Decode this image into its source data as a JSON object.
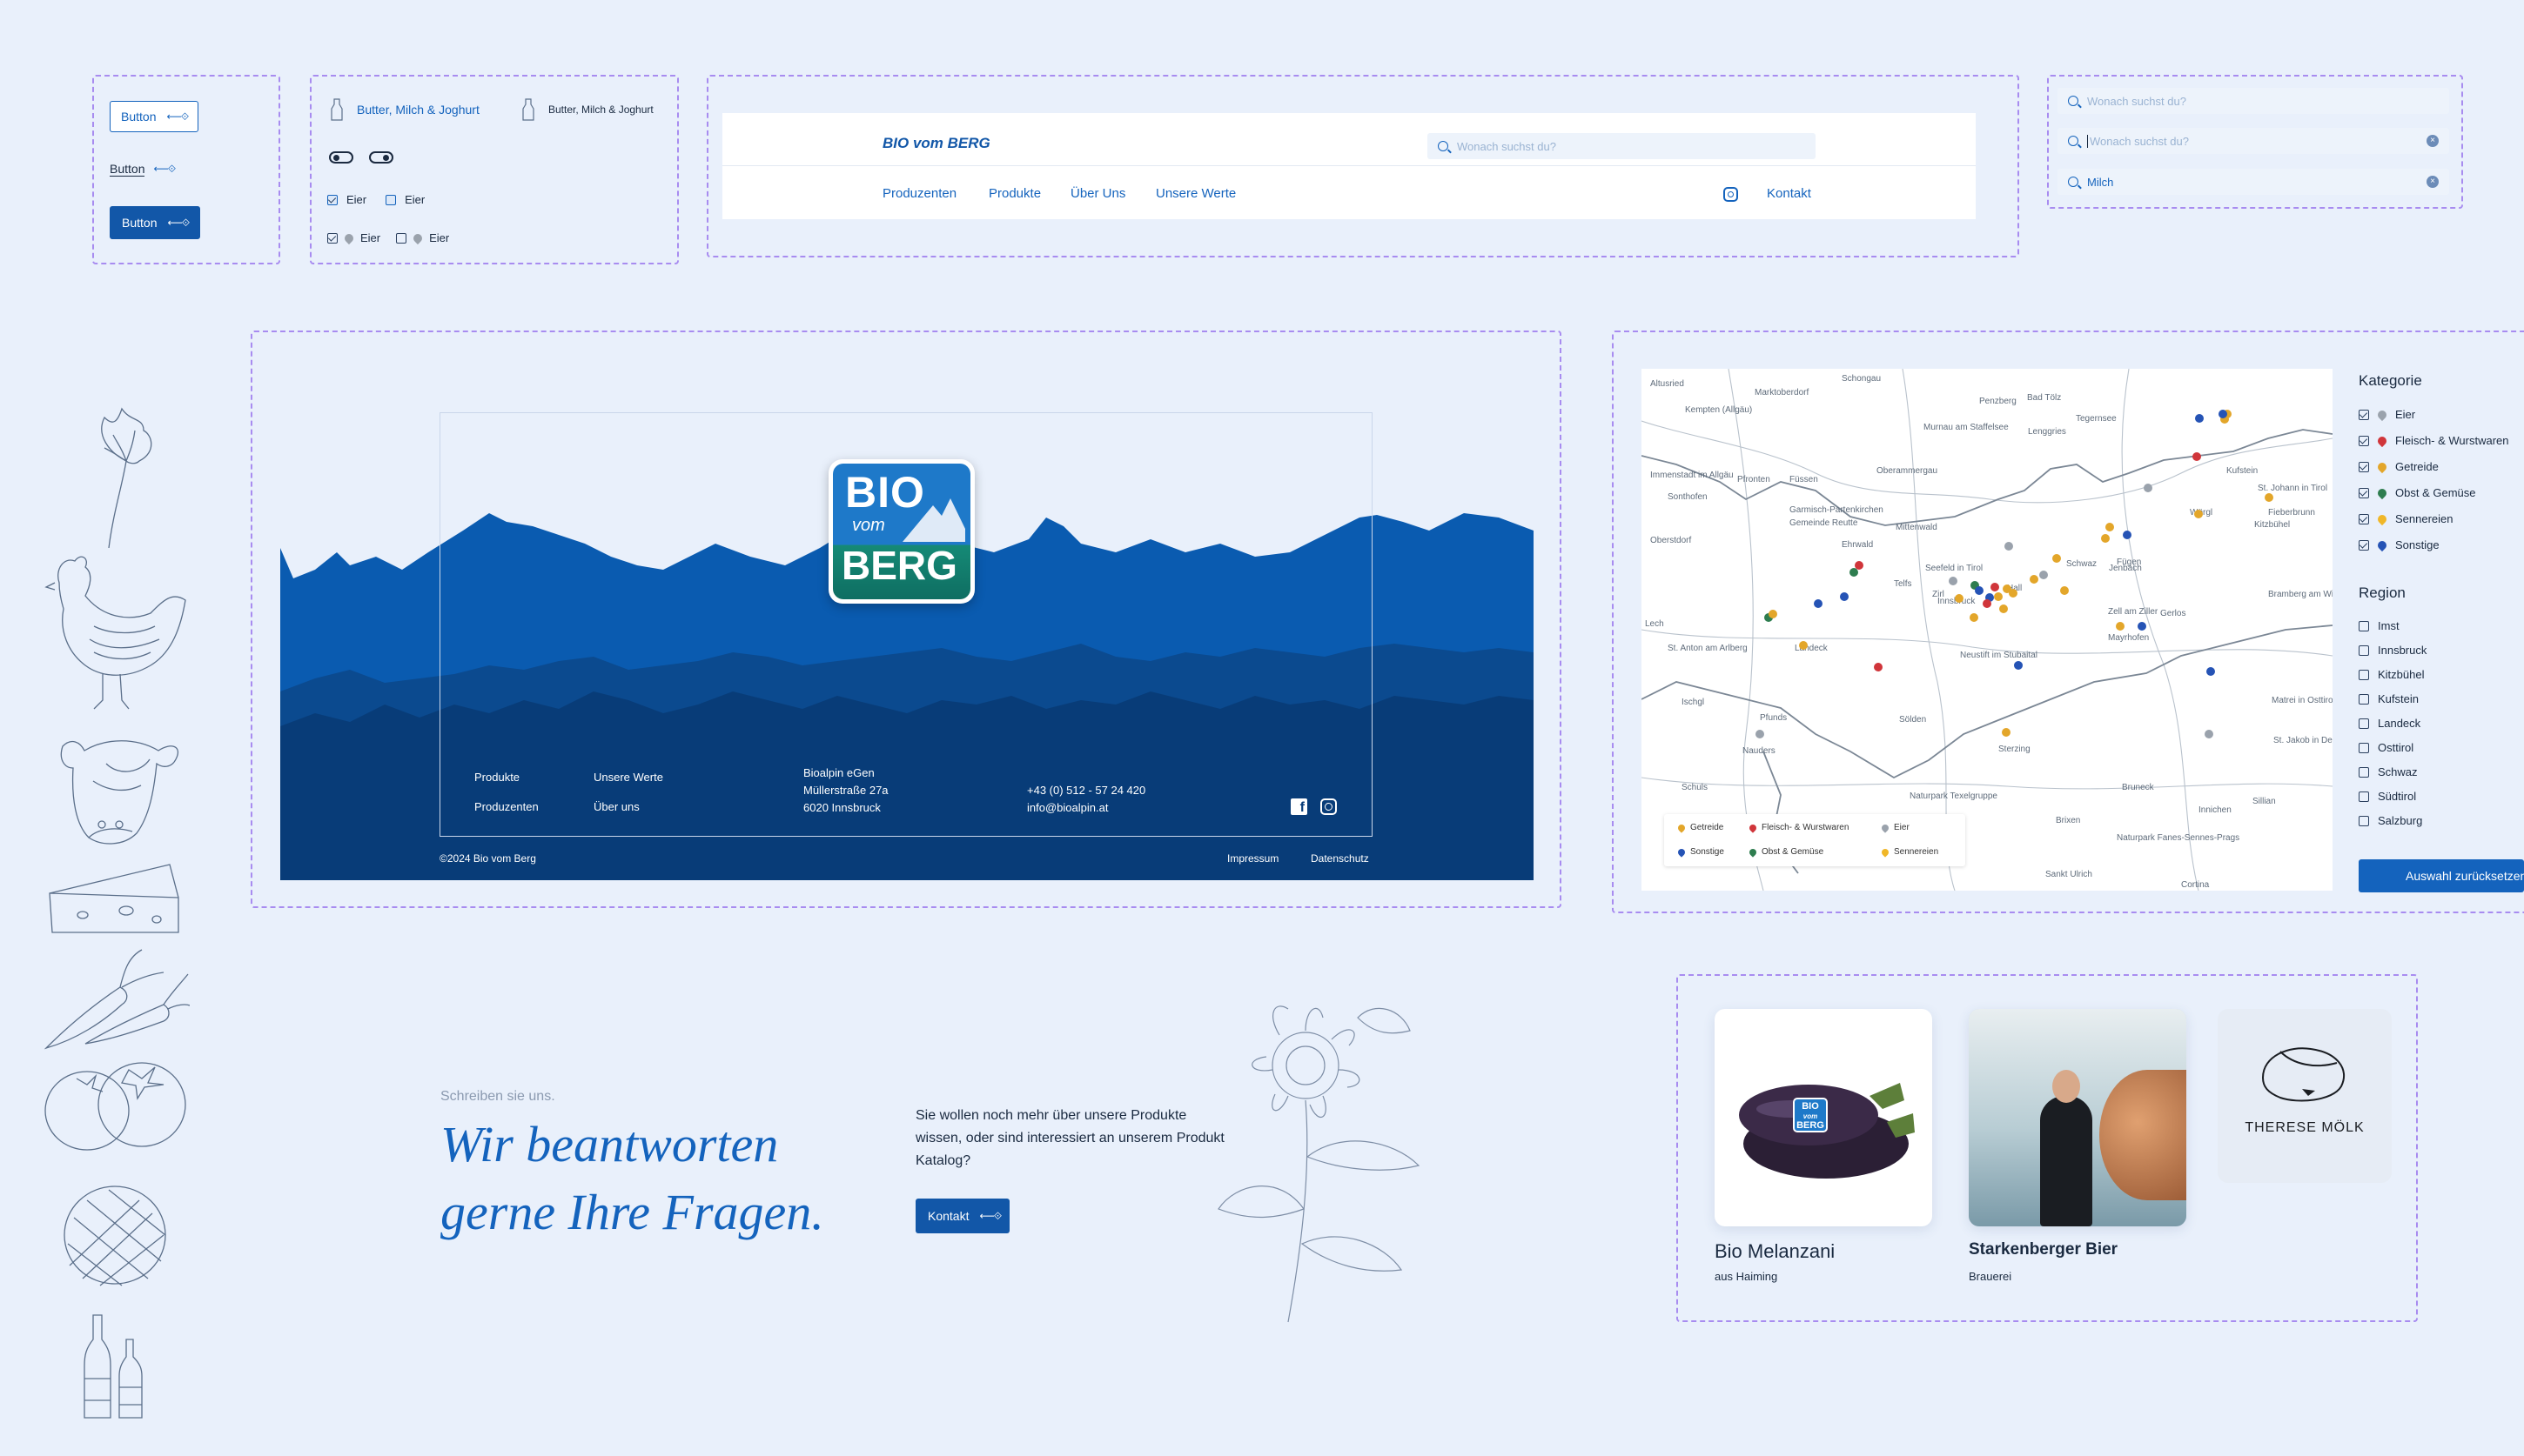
{
  "buttons": {
    "outline_label": "Button",
    "text_label": "Button",
    "filled_label": "Button",
    "arrow": "⟵⟐"
  },
  "controls": {
    "tag_active": "Butter, Milch & Joghurt",
    "tag_default": "Butter, Milch & Joghurt",
    "checkbox_labels": [
      "Eier",
      "Eier"
    ],
    "pin_labels": [
      "Eier",
      "Eier"
    ]
  },
  "header": {
    "logo": "BIO vom BERG",
    "search_placeholder": "Wonach suchst du?",
    "nav": [
      "Produzenten",
      "Produkte",
      "Über Uns",
      "Unsere Werte"
    ],
    "contact": "Kontakt"
  },
  "search_states": [
    {
      "text": "Wonach suchst du?",
      "state": "empty"
    },
    {
      "text": "Wonach suchst du?",
      "state": "focused"
    },
    {
      "text": "Milch",
      "state": "filled"
    }
  ],
  "footer": {
    "logo_lines": [
      "BIO",
      "vom",
      "BERG"
    ],
    "col1": [
      "Produkte",
      "Produzenten"
    ],
    "col2": [
      "Unsere Werte",
      "Über uns"
    ],
    "address": [
      "Bioalpin eGen",
      "Müllerstraße 27a",
      "6020 Innsbruck"
    ],
    "contact": [
      "+43 (0) 512 - 57 24 420",
      "info@bioalpin.at"
    ],
    "copyright": "©2024 Bio vom Berg",
    "legal": [
      "Impressum",
      "Datenschutz"
    ],
    "colors": {
      "sky": "#ffffff",
      "mid": "#0a5bb0",
      "deep": "#0b4a8f",
      "darkest": "#083c78"
    }
  },
  "map": {
    "places": [
      "Altusried",
      "Marktoberdorf",
      "Schongau",
      "Oberammergau",
      "Penzberg",
      "Bad Tölz",
      "Kempten (Allgäu)",
      "Murnau am Staffelsee",
      "Lenggries",
      "Tegernsee",
      "Immenstadt im Allgäu",
      "Sonthofen",
      "Oberstdorf",
      "Pfronten",
      "Füssen",
      "Garmisch-Partenkirchen",
      "Gemeinde Reutte",
      "Ehrwald",
      "Mittenwald",
      "Seefeld in Tirol",
      "Telfs",
      "Innsbruck",
      "Schwaz",
      "Zirl",
      "Hall",
      "Jenbach",
      "Fügen",
      "Kufstein",
      "Wörgl",
      "St. Johann in Tirol",
      "Kitzbühel",
      "Fieberbrunn",
      "Lech",
      "Landeck",
      "St. Anton am Arlberg",
      "Ischgl",
      "Pfunds",
      "Nauders",
      "Sölden",
      "Neustift im Stubaital",
      "Zell am Ziller",
      "Gerlos",
      "Mayrhofen",
      "Bramberg am Wildkogel",
      "Matrei in Osttirol",
      "St. Jakob in Defereggen",
      "Sterzing",
      "Bruneck",
      "Brixen",
      "Innichen",
      "Sillian",
      "Naturpark Texelgruppe",
      "Naturpark Fanes-Sennes-Prags",
      "Schuls",
      "Sankt Ulrich",
      "Cortina"
    ],
    "legend": [
      "Getreide",
      "Fleisch- & Wurstwaren",
      "Eier",
      "Sonstige",
      "Obst & Gemüse",
      "Sennereien"
    ],
    "legend_colors": [
      "#e3a62a",
      "#d0353a",
      "#9aa2ac",
      "#2553b5",
      "#2e7d4f",
      "#f0b728"
    ]
  },
  "filters": {
    "kategorie_title": "Kategorie",
    "kategorie": [
      "Eier",
      "Fleisch- & Wurstwaren",
      "Getreide",
      "Obst & Gemüse",
      "Sennereien",
      "Sonstige"
    ],
    "kategorie_colors": [
      "#9aa2ac",
      "#d0353a",
      "#e3a62a",
      "#2e7d4f",
      "#f0b728",
      "#2553b5"
    ],
    "region_title": "Region",
    "region": [
      "Imst",
      "Innsbruck",
      "Kitzbühel",
      "Kufstein",
      "Landeck",
      "Osttirol",
      "Schwaz",
      "Südtirol",
      "Salzburg"
    ],
    "reset_label": "Auswahl zurücksetzen"
  },
  "contact_section": {
    "eyebrow": "Schreiben sie uns.",
    "headline_1": "Wir beantworten",
    "headline_2": "gerne Ihre Fragen.",
    "body": "Sie wollen noch mehr über unsere Produkte wissen, oder sind interessiert an unserem Produkt Katalog?",
    "button": "Kontakt"
  },
  "cards": [
    {
      "title": "Bio Melanzani",
      "subtitle": "aus Haiming",
      "badge": [
        "BIO",
        "vom",
        "BERG"
      ]
    },
    {
      "title": "Starkenberger Bier",
      "subtitle": "Brauerei"
    },
    {
      "logo_text": "THERESE MÖLK"
    }
  ]
}
